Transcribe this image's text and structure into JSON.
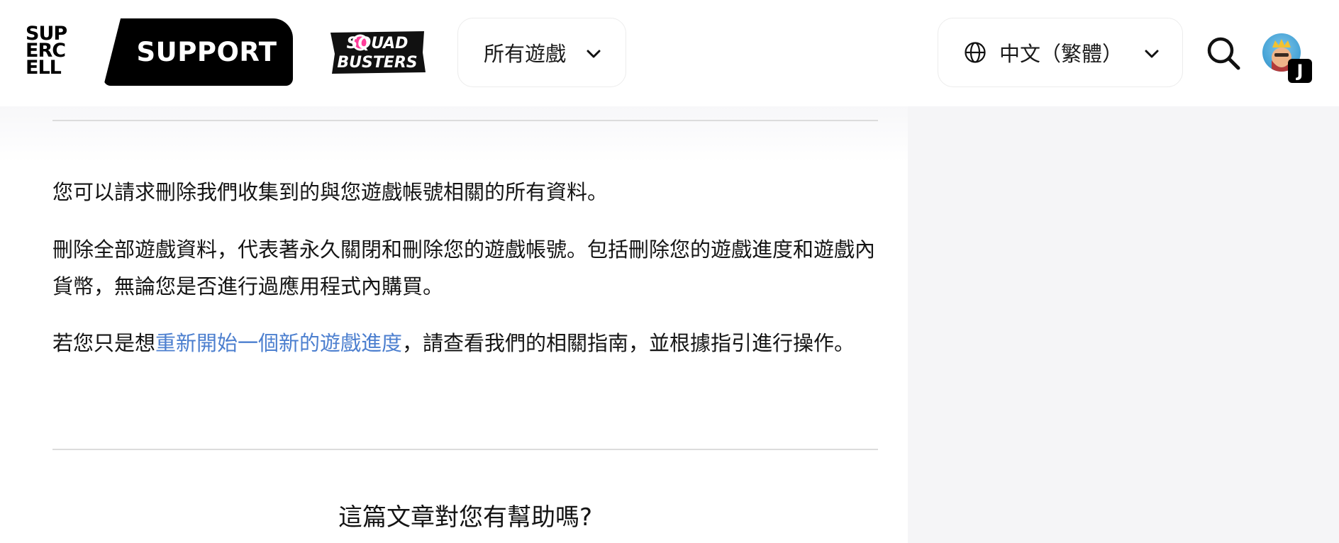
{
  "header": {
    "logo_lines": [
      "SUP",
      "ERC",
      "ELL"
    ],
    "support_label": "SUPPORT",
    "game_logo_lines": [
      "SQUAD",
      "BUSTERS"
    ],
    "games_dropdown_label": "所有遊戲",
    "language_dropdown_label": "中文（繁體）",
    "avatar_initial": "J"
  },
  "article": {
    "paragraph_1": "您可以請求刪除我們收集到的與您遊戲帳號相關的所有資料。",
    "paragraph_2": "刪除全部遊戲資料，代表著永久關閉和刪除您的遊戲帳號。包括刪除您的遊戲進度和遊戲內貨幣，無論您是否進行過應用程式內購買。",
    "paragraph_3_before": "若您只是想",
    "paragraph_3_link": "重新開始一個新的遊戲進度",
    "paragraph_3_after": "，請查看我們的相關指南，並根據指引進行操作。",
    "helpful_question": "這篇文章對您有幫助嗎?"
  },
  "colors": {
    "link": "#4c7fcf",
    "sidebar_bg": "#f5f5f7",
    "badge_bg": "#000000"
  },
  "icons": {
    "games_chevron": "chevron-down-icon",
    "language_globe": "globe-icon",
    "language_chevron": "chevron-down-icon",
    "search": "search-icon"
  }
}
